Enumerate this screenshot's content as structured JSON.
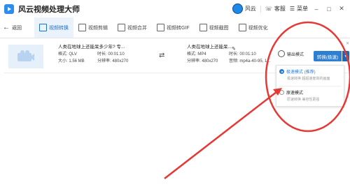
{
  "app": {
    "title": "风云视频处理大师",
    "user": "风云",
    "service": "客服",
    "menu": "菜单"
  },
  "nav": {
    "back": "返回",
    "tabs": [
      "视频转换",
      "视频剪辑",
      "视频合并",
      "视频转GIF",
      "视频截图",
      "视频优化"
    ]
  },
  "file": {
    "source_name": "人类在地球上还能呆多少年? 专...",
    "source_format": "格式: QLV",
    "source_duration": "时长: 00:01:10",
    "source_size": "大小: 1.56 MB",
    "source_resolution": "分辨率: 480x270",
    "target_name": "人类在地球上还能呆...",
    "target_format": "格式: MP4",
    "target_duration": "时长: 00:01:10",
    "target_resolution": "分辨率: 480x270",
    "target_audio": "音频: mp4a-40-95, 1..."
  },
  "actions": {
    "settings": "输出模式",
    "convert": "转换(极速)"
  },
  "dropdown": {
    "options": [
      {
        "title": "极速模式 (推荐)",
        "desc": "极速转换 超超速度高的画面",
        "selected": true
      },
      {
        "title": "原速模式",
        "desc": "原速转换 兼容性更强"
      }
    ]
  },
  "colors": {
    "accent": "#2d7fd3",
    "annotation": "#e53935"
  }
}
